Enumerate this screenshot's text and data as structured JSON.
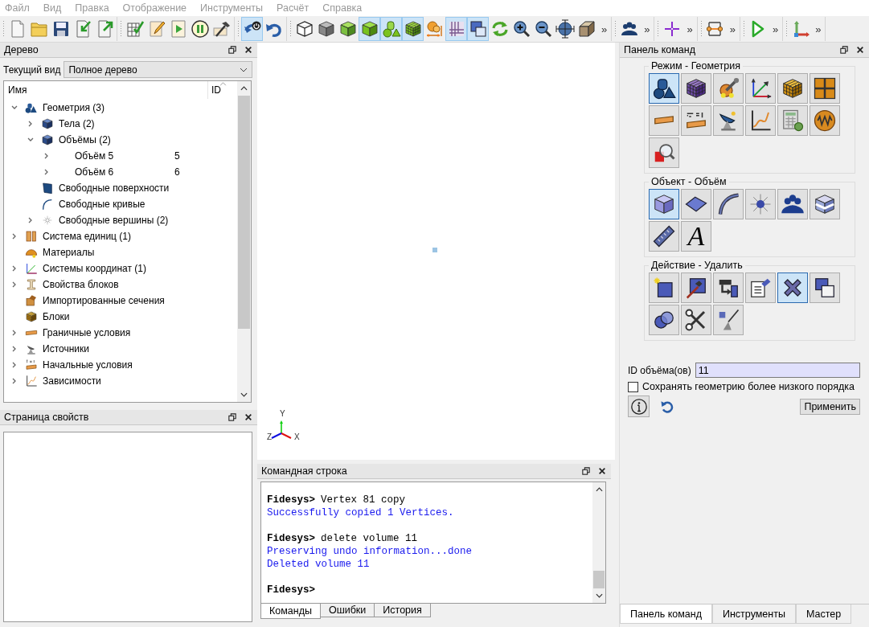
{
  "menu": [
    "Файл",
    "Вид",
    "Правка",
    "Отображение",
    "Инструменты",
    "Расчёт",
    "Справка"
  ],
  "toolbar": [
    {
      "items": [
        {
          "selected": false
        },
        {
          "selected": false
        },
        {
          "selected": false
        },
        {
          "selected": false
        },
        {
          "selected": false
        }
      ]
    },
    {
      "items": [
        {
          "selected": false
        },
        {
          "selected": false
        },
        {
          "selected": false
        },
        {
          "selected": false
        },
        {
          "selected": false
        }
      ]
    },
    {
      "items": [
        {
          "selected": true
        },
        {
          "selected": false
        }
      ]
    },
    {
      "items": [
        {
          "selected": false
        },
        {
          "selected": false
        },
        {
          "selected": false
        },
        {
          "selected": true
        },
        {
          "selected": true
        },
        {
          "selected": true
        },
        {
          "selected": false
        },
        {
          "selected": true
        },
        {
          "selected": true
        },
        {
          "selected": false
        },
        {
          "selected": false
        },
        {
          "selected": false
        },
        {
          "selected": false
        },
        {
          "selected": false
        }
      ],
      "overflow": "»"
    },
    {
      "items": [
        {
          "selected": false
        }
      ],
      "overflow": "»"
    },
    {
      "items": [
        {
          "selected": false
        }
      ],
      "overflow": "»"
    },
    {
      "items": [
        {
          "selected": false
        }
      ],
      "overflow": "»"
    },
    {
      "items": [
        {
          "selected": false
        }
      ],
      "overflow": "»"
    },
    {
      "items": [
        {
          "selected": false
        }
      ],
      "overflow": "»"
    }
  ],
  "tree_panel": {
    "title": "Дерево",
    "view_label": "Текущий вид",
    "view_value": "Полное дерево",
    "columns": [
      "Имя",
      "ID"
    ],
    "nodes": [
      {
        "label": "Геометрия (3)",
        "expanded": true,
        "children": [
          {
            "label": "Тела (2)",
            "expanded": false
          },
          {
            "label": "Объёмы (2)",
            "expanded": true,
            "children": [
              {
                "label": "Объём 5",
                "id": "5",
                "expanded": false
              },
              {
                "label": "Объём 6",
                "id": "6",
                "expanded": false
              }
            ]
          },
          {
            "label": "Свободные поверхности"
          },
          {
            "label": "Свободные кривые"
          },
          {
            "label": "Свободные вершины (2)",
            "expanded": false
          }
        ]
      },
      {
        "label": "Система единиц (1)",
        "expanded": false
      },
      {
        "label": "Материалы"
      },
      {
        "label": "Системы координат (1)",
        "expanded": false
      },
      {
        "label": "Свойства блоков",
        "expanded": false
      },
      {
        "label": "Импортированные сечения"
      },
      {
        "label": "Блоки"
      },
      {
        "label": "Граничные условия",
        "expanded": false
      },
      {
        "label": "Источники",
        "expanded": false
      },
      {
        "label": "Начальные условия",
        "expanded": false
      },
      {
        "label": "Зависимости",
        "expanded": false
      }
    ]
  },
  "properties_panel": {
    "title": "Страница свойств"
  },
  "viewport": {
    "axes": {
      "y": "Y",
      "z": "Z",
      "x": "X"
    }
  },
  "command_line": {
    "title": "Командная строка",
    "lines": [
      {
        "kind": "input",
        "prompt": "Fidesys>",
        "text": "Vertex 81 copy"
      },
      {
        "kind": "output",
        "text": "Successfully copied 1 Vertices."
      },
      {
        "kind": "input",
        "prompt": "Fidesys>",
        "text": "delete volume 11"
      },
      {
        "kind": "output",
        "text": "Preserving undo information...done"
      },
      {
        "kind": "output",
        "text": "Deleted volume 11"
      },
      {
        "kind": "input",
        "prompt": "Fidesys>"
      }
    ],
    "tabs": [
      {
        "label": "Команды",
        "selected": true
      },
      {
        "label": "Ошибки",
        "selected": false
      },
      {
        "label": "История",
        "selected": false
      }
    ]
  },
  "command_panel": {
    "title": "Панель команд",
    "groups": [
      {
        "title": "Режим - Геометрия",
        "buttons": [
          {
            "selected": true
          },
          {
            "selected": false
          },
          {
            "selected": false
          },
          {
            "selected": false
          },
          {
            "selected": false
          },
          {
            "selected": false
          },
          {
            "selected": false
          },
          {
            "selected": false
          },
          {
            "selected": false
          },
          {
            "selected": false
          },
          {
            "selected": false
          },
          {
            "selected": false
          },
          {
            "selected": false
          }
        ]
      },
      {
        "title": "Объект - Объём",
        "buttons": [
          {
            "selected": true
          },
          {
            "selected": false
          },
          {
            "selected": false
          },
          {
            "selected": false
          },
          {
            "selected": false
          },
          {
            "selected": false
          },
          {
            "selected": false
          },
          {
            "selected": false,
            "glyph": "A"
          }
        ]
      },
      {
        "title": "Действие - Удалить",
        "buttons": [
          {
            "selected": false
          },
          {
            "selected": false
          },
          {
            "selected": false
          },
          {
            "selected": false
          },
          {
            "selected": true
          },
          {
            "selected": false
          },
          {
            "selected": false
          },
          {
            "selected": false
          },
          {
            "selected": false
          }
        ]
      }
    ],
    "id_label": "ID объёма(ов)",
    "id_value": "11",
    "checkbox": {
      "label": "Сохранять геометрию более низкого порядка",
      "checked": false
    },
    "apply": "Применить",
    "tabs": [
      {
        "label": "Панель команд",
        "selected": true
      },
      {
        "label": "Инструменты",
        "selected": false
      },
      {
        "label": "Мастер",
        "selected": false
      }
    ]
  }
}
